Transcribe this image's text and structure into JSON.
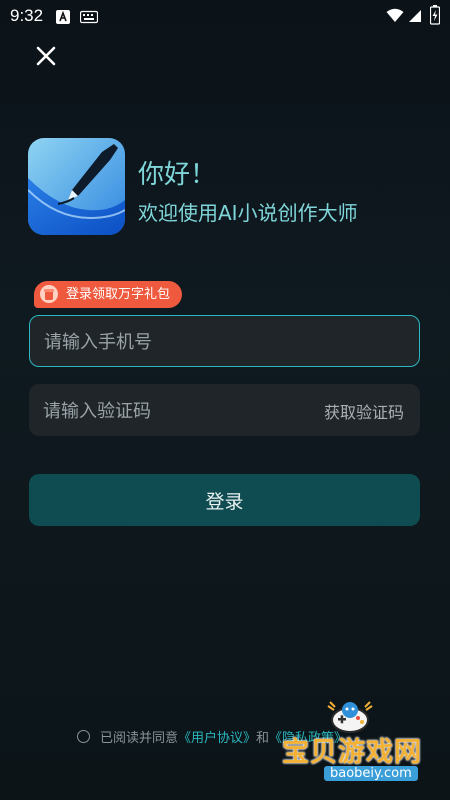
{
  "status_bar": {
    "time": "9:32",
    "icons": [
      "app-a-icon",
      "keyboard-icon",
      "wifi-icon",
      "signal-icon",
      "battery-charging-icon"
    ]
  },
  "header": {
    "close_icon": "close-icon"
  },
  "hero": {
    "greeting": "你好！",
    "welcome": "欢迎使用AI小说创作大师"
  },
  "promo_badge": {
    "label": "登录领取万字礼包"
  },
  "phone_field": {
    "placeholder": "请输入手机号",
    "value": ""
  },
  "code_field": {
    "placeholder": "请输入验证码",
    "value": "",
    "get_code_label": "获取验证码"
  },
  "login_button": {
    "label": "登录"
  },
  "agreement": {
    "prefix": "已阅读并同意",
    "user_agreement": "《用户协议》",
    "conjunction": "和",
    "privacy_policy": "《隐私政策》"
  },
  "watermark": {
    "title": "宝贝游戏网",
    "url": "baobeiy.com"
  },
  "colors": {
    "accent": "#2bb7bf",
    "login_button": "#0e4c51",
    "badge": "#ef5a3f",
    "field_bg": "#1f2529"
  }
}
